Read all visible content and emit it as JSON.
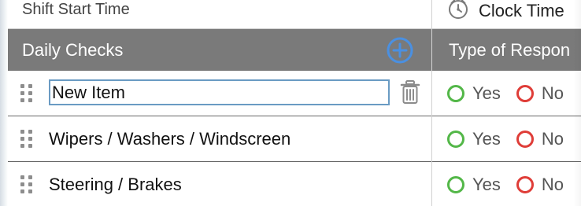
{
  "top": {
    "shift_start_label": "Shift Start Time",
    "clock_time_label": "Clock Time"
  },
  "header": {
    "daily_checks_label": "Daily Checks",
    "response_type_label": "Type of Respon"
  },
  "rows": [
    {
      "name": "New Item",
      "editable": true,
      "yes_label": "Yes",
      "no_label": "No"
    },
    {
      "name": "Wipers / Washers / Windscreen",
      "editable": false,
      "yes_label": "Yes",
      "no_label": "No"
    },
    {
      "name": "Steering / Brakes",
      "editable": false,
      "yes_label": "Yes",
      "no_label": "No"
    }
  ],
  "icons": {
    "clock": "clock-icon",
    "add": "plus-icon",
    "delete": "trash-icon",
    "drag": "drag-handle-icon",
    "yes": "radio-yes-icon",
    "no": "radio-no-icon"
  },
  "colors": {
    "header_bg": "#7a7a7a",
    "accent_blue": "#4a90e2",
    "yes_green": "#53b748",
    "no_red": "#df3d38"
  }
}
